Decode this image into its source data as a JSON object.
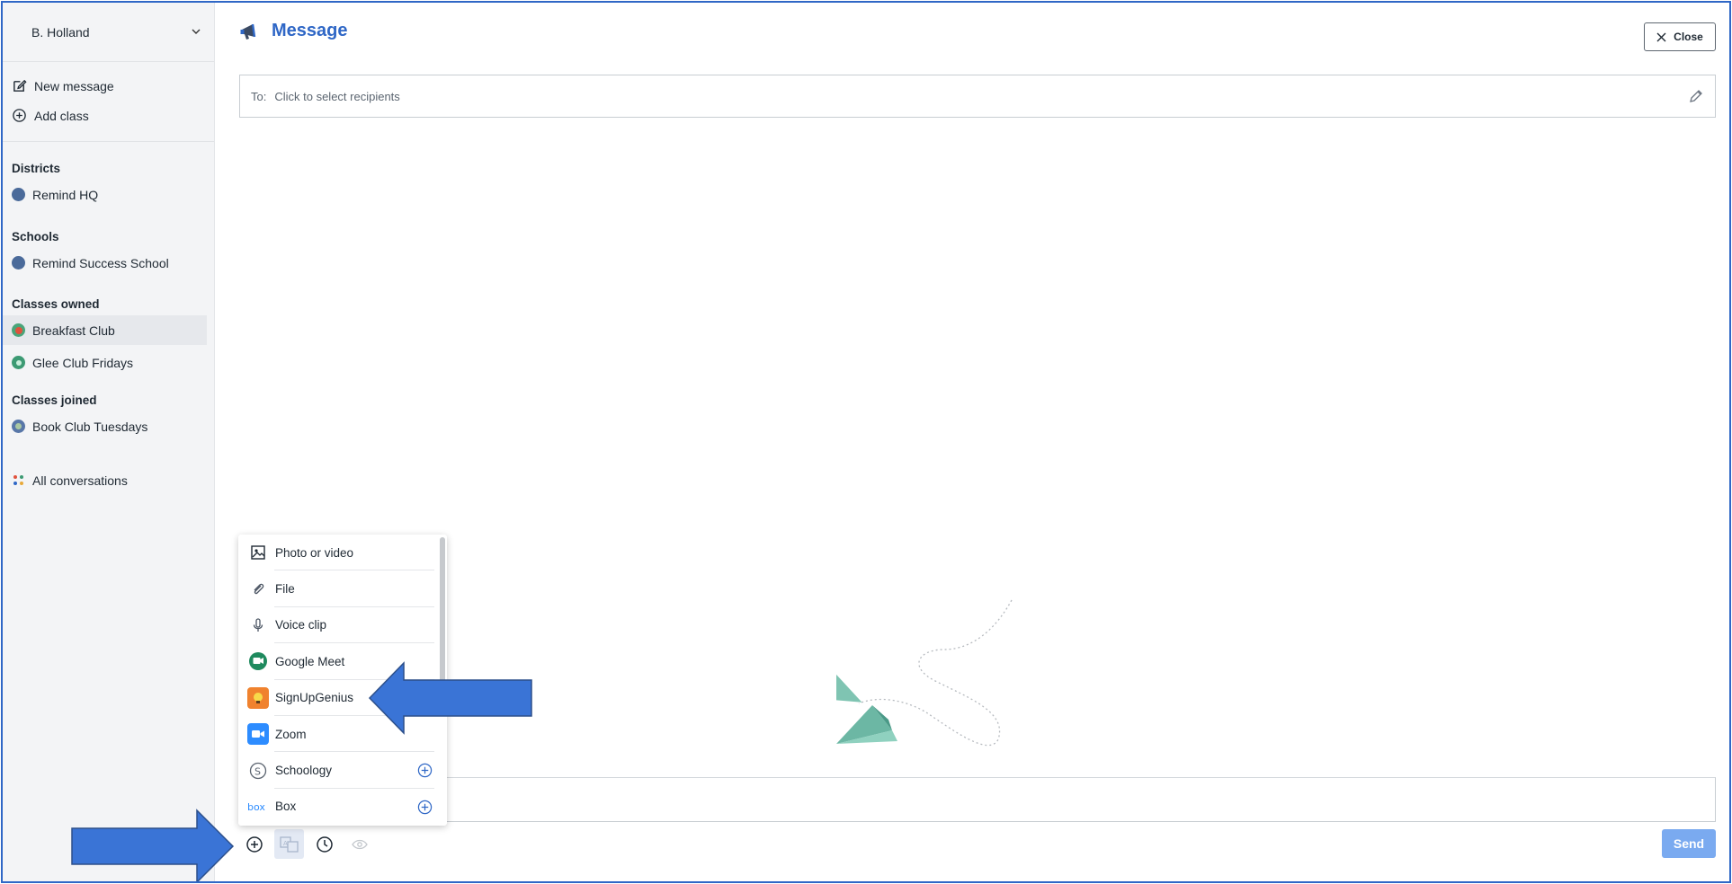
{
  "sidebar": {
    "user_name": "B. Holland",
    "actions": [
      {
        "label": "New message",
        "icon": "compose-icon"
      },
      {
        "label": "Add class",
        "icon": "plus-circle-icon"
      }
    ],
    "districts_heading": "Districts",
    "districts": [
      {
        "label": "Remind HQ"
      }
    ],
    "schools_heading": "Schools",
    "schools": [
      {
        "label": "Remind Success School"
      }
    ],
    "owned_heading": "Classes owned",
    "owned": [
      {
        "label": "Breakfast Club"
      },
      {
        "label": "Glee Club Fridays"
      }
    ],
    "joined_heading": "Classes joined",
    "joined": [
      {
        "label": "Book Club Tuesdays"
      }
    ],
    "all_conversations": "All conversations"
  },
  "main": {
    "title": "Message",
    "close_label": "Close",
    "to_label": "To:",
    "to_placeholder": "Click to select recipients",
    "send_label": "Send"
  },
  "attach_menu": {
    "items": [
      {
        "label": "Photo or video",
        "icon": "image-icon"
      },
      {
        "label": "File",
        "icon": "paperclip-icon"
      },
      {
        "label": "Voice clip",
        "icon": "microphone-icon"
      },
      {
        "label": "Google Meet",
        "icon": "google-meet-icon"
      },
      {
        "label": "SignUpGenius",
        "icon": "signupgenius-icon"
      },
      {
        "label": "Zoom",
        "icon": "zoom-icon"
      },
      {
        "label": "Schoology",
        "icon": "schoology-icon"
      },
      {
        "label": "Box",
        "icon": "box-icon"
      }
    ]
  },
  "colors": {
    "accent": "#2f67c6",
    "send_disabled": "#7aaaf0",
    "annotation_arrow": "#3a74d6"
  }
}
